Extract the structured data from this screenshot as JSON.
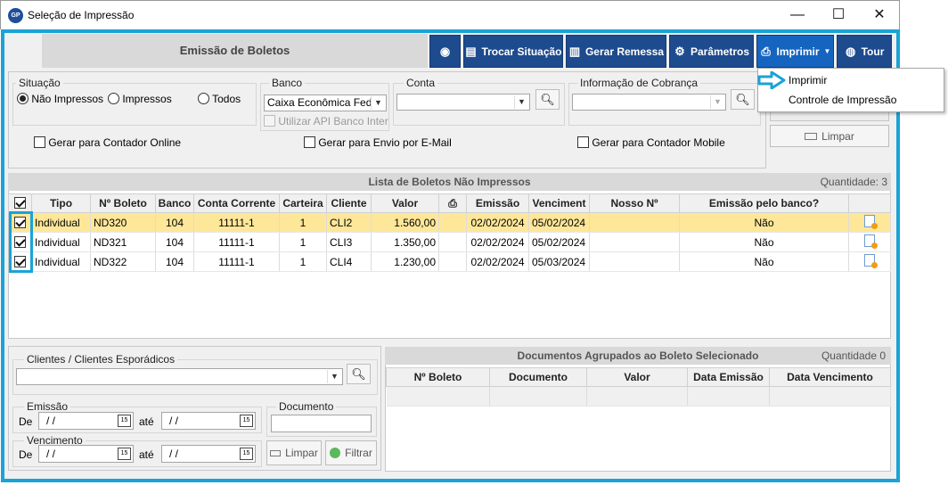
{
  "window": {
    "logo": "GP",
    "title": "Seleção de Impressão",
    "controls": [
      "—",
      "☐",
      "✕"
    ]
  },
  "header": {
    "title": "Emissão de Boletos",
    "buttons": [
      {
        "label": "",
        "icon": "pin-icon"
      },
      {
        "label": "Trocar Situação",
        "icon": "document-edit-icon"
      },
      {
        "label": "Gerar Remessa",
        "icon": "ledger-icon"
      },
      {
        "label": "Parâmetros",
        "icon": "gear-icon"
      },
      {
        "label": "Imprimir",
        "icon": "printer-icon"
      },
      {
        "label": "Tour",
        "icon": "globe-icon"
      }
    ]
  },
  "print_menu": {
    "items": [
      "Imprimir",
      "Controle de Impressão"
    ]
  },
  "filters": {
    "situacao": {
      "label": "Situação",
      "options": [
        "Não Impressos",
        "Impressos",
        "Todos"
      ],
      "selected": "Não Impressos"
    },
    "banco": {
      "label": "Banco",
      "value": "Caixa Econômica Feder",
      "api_checkbox": "Utilizar API Banco Inter"
    },
    "conta": {
      "label": "Conta",
      "value": ""
    },
    "info_cobranca": {
      "label": "Informação de Cobrança",
      "value": ""
    },
    "checks": [
      "Gerar para Contador Online",
      "Gerar para Envio por E-Mail",
      "Gerar para Contador Mobile"
    ],
    "limpar_label": "Limpar"
  },
  "list": {
    "title": "Lista de Boletos Não Impressos",
    "quantity_label": "Quantidade: 3",
    "columns": [
      "",
      "Tipo",
      "Nº Boleto",
      "Banco",
      "Conta Corrente",
      "Carteira",
      "Cliente",
      "Valor",
      "",
      "Emissão",
      "Venciment",
      "Nosso Nº",
      "Emissão pelo banco?",
      ""
    ],
    "rows": [
      {
        "tipo": "Individual",
        "boleto": "ND320",
        "banco": "104",
        "conta": "11111-1",
        "carteira": "1",
        "cliente": "CLI2",
        "valor": "1.560,00",
        "emissao": "02/02/2024",
        "vencimento": "05/02/2024",
        "nosso": "",
        "emissao_banco": "Não"
      },
      {
        "tipo": "Individual",
        "boleto": "ND321",
        "banco": "104",
        "conta": "11111-1",
        "carteira": "1",
        "cliente": "CLI3",
        "valor": "1.350,00",
        "emissao": "02/02/2024",
        "vencimento": "05/02/2024",
        "nosso": "",
        "emissao_banco": "Não"
      },
      {
        "tipo": "Individual",
        "boleto": "ND322",
        "banco": "104",
        "conta": "11111-1",
        "carteira": "1",
        "cliente": "CLI4",
        "valor": "1.230,00",
        "emissao": "02/02/2024",
        "vencimento": "05/03/2024",
        "nosso": "",
        "emissao_banco": "Não"
      }
    ]
  },
  "bottom": {
    "clientes_label": "Clientes / Clientes Esporádicos",
    "emissao_label": "Emissão",
    "vencimento_label": "Vencimento",
    "de": "De",
    "ate": "até",
    "date_placeholder": " /  /",
    "documento_label": "Documento",
    "limpar_label": "Limpar",
    "filtrar_label": "Filtrar"
  },
  "docs": {
    "title": "Documentos Agrupados ao Boleto Selecionado",
    "quantity_label": "Quantidade 0",
    "columns": [
      "Nº Boleto",
      "Documento",
      "Valor",
      "Data Emissão",
      "Data Vencimento"
    ]
  },
  "colors": {
    "accent": "#1aa3d6",
    "toolbar": "#1e4b8e",
    "selected_row": "#ffe799"
  }
}
